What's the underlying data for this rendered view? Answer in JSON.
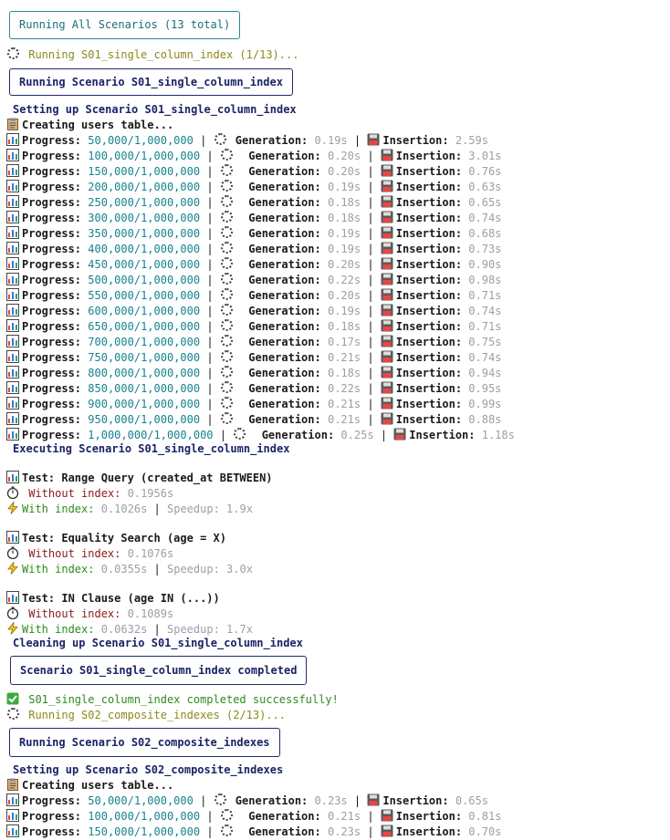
{
  "header_box": "Running All Scenarios (13 total)",
  "scenario1": {
    "running": "Running S01_single_column_index (1/13)...",
    "title_box": "Running Scenario S01_single_column_index",
    "setup": "Setting up Scenario S01_single_column_index",
    "creating": "Creating users table...",
    "progress": [
      {
        "done": "50,000/1,000,000",
        "gen": "0.19s",
        "ins": "2.59s"
      },
      {
        "done": "100,000/1,000,000",
        "gen": "0.20s",
        "ins": "3.01s"
      },
      {
        "done": "150,000/1,000,000",
        "gen": "0.20s",
        "ins": "0.76s"
      },
      {
        "done": "200,000/1,000,000",
        "gen": "0.19s",
        "ins": "0.63s"
      },
      {
        "done": "250,000/1,000,000",
        "gen": "0.18s",
        "ins": "0.65s"
      },
      {
        "done": "300,000/1,000,000",
        "gen": "0.18s",
        "ins": "0.74s"
      },
      {
        "done": "350,000/1,000,000",
        "gen": "0.19s",
        "ins": "0.68s"
      },
      {
        "done": "400,000/1,000,000",
        "gen": "0.19s",
        "ins": "0.73s"
      },
      {
        "done": "450,000/1,000,000",
        "gen": "0.20s",
        "ins": "0.90s"
      },
      {
        "done": "500,000/1,000,000",
        "gen": "0.22s",
        "ins": "0.98s"
      },
      {
        "done": "550,000/1,000,000",
        "gen": "0.20s",
        "ins": "0.71s"
      },
      {
        "done": "600,000/1,000,000",
        "gen": "0.19s",
        "ins": "0.74s"
      },
      {
        "done": "650,000/1,000,000",
        "gen": "0.18s",
        "ins": "0.71s"
      },
      {
        "done": "700,000/1,000,000",
        "gen": "0.17s",
        "ins": "0.75s"
      },
      {
        "done": "750,000/1,000,000",
        "gen": "0.21s",
        "ins": "0.74s"
      },
      {
        "done": "800,000/1,000,000",
        "gen": "0.18s",
        "ins": "0.94s"
      },
      {
        "done": "850,000/1,000,000",
        "gen": "0.22s",
        "ins": "0.95s"
      },
      {
        "done": "900,000/1,000,000",
        "gen": "0.21s",
        "ins": "0.99s"
      },
      {
        "done": "950,000/1,000,000",
        "gen": "0.21s",
        "ins": "0.88s"
      },
      {
        "done": "1,000,000/1,000,000",
        "gen": "0.25s",
        "ins": "1.18s"
      }
    ],
    "executing": "Executing Scenario S01_single_column_index",
    "tests": [
      {
        "name": "Test: Range Query (created_at BETWEEN)",
        "without": "0.1956s",
        "with": "0.1026s",
        "speedup": "1.9x"
      },
      {
        "name": "Test: Equality Search (age = X)",
        "without": "0.1076s",
        "with": "0.0355s",
        "speedup": "3.0x"
      },
      {
        "name": "Test: IN Clause (age IN (...))",
        "without": "0.1089s",
        "with": "0.0632s",
        "speedup": "1.7x"
      }
    ],
    "cleaning": "Cleaning up Scenario S01_single_column_index",
    "completed_box": "Scenario S01_single_column_index completed",
    "success": "S01_single_column_index completed successfully!"
  },
  "scenario2": {
    "running": "Running S02_composite_indexes (2/13)...",
    "title_box": "Running Scenario S02_composite_indexes",
    "setup": "Setting up Scenario S02_composite_indexes",
    "creating": "Creating users table...",
    "progress": [
      {
        "done": "50,000/1,000,000",
        "gen": "0.23s",
        "ins": "0.65s"
      },
      {
        "done": "100,000/1,000,000",
        "gen": "0.21s",
        "ins": "0.81s"
      },
      {
        "done": "150,000/1,000,000",
        "gen": "0.23s",
        "ins": "0.70s"
      }
    ]
  },
  "labels": {
    "progress": "Progress:",
    "generation": "Generation:",
    "insertion": "Insertion:",
    "without": "Without index:",
    "with": "With index:",
    "speedup": "Speedup:",
    "sep": "|"
  },
  "colors": {
    "teal": "#16838c",
    "navy": "#1b2366",
    "olive": "#8a8a1c",
    "green": "#2e8b1e",
    "gray": "#9aa0a6",
    "darkred": "#8b1a1a"
  }
}
